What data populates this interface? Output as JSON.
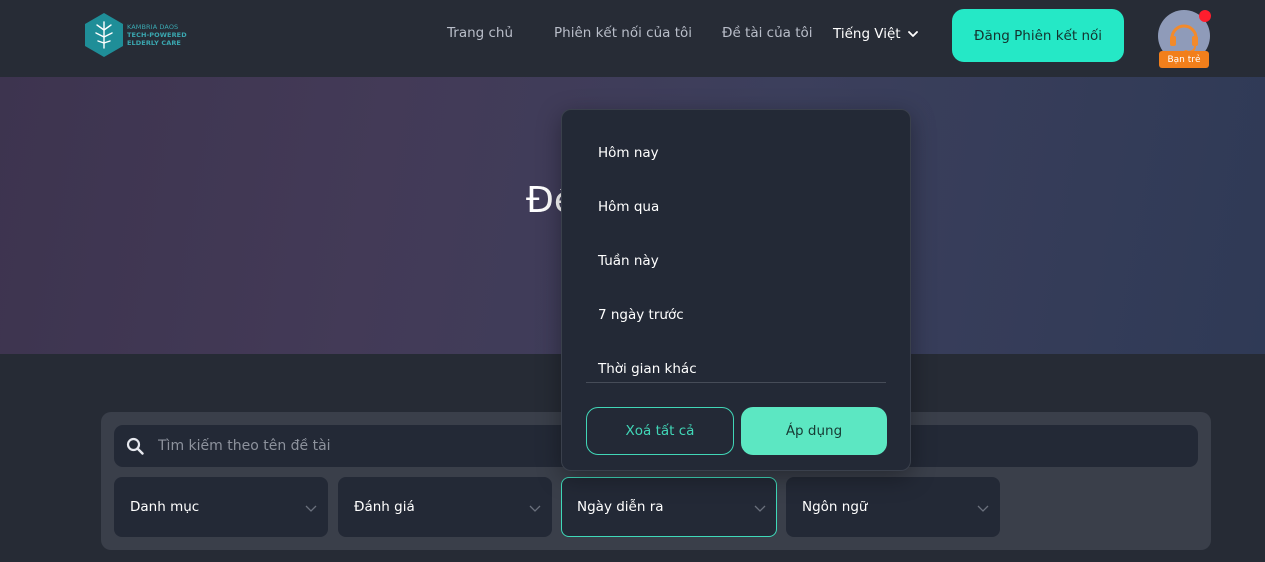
{
  "brand": {
    "line1": "KAMBRIA DAOS",
    "line2": "TECH-POWERED",
    "line3": "ELDERLY CARE"
  },
  "nav": {
    "items": [
      {
        "label": "Trang chủ"
      },
      {
        "label": "Phiên kết nối của tôi"
      },
      {
        "label": "Đề tài của tôi"
      }
    ],
    "language": "Tiếng Việt",
    "cta_label": "Đăng Phiên kết nối",
    "user_role": "Bạn trẻ"
  },
  "hero": {
    "title_visible": "Đề"
  },
  "search": {
    "placeholder": "Tìm kiếm theo tên đề tài"
  },
  "filters": [
    {
      "label": "Danh mục"
    },
    {
      "label": "Đánh giá"
    },
    {
      "label": "Ngày diễn ra"
    },
    {
      "label": "Ngôn ngữ"
    }
  ],
  "date_dropdown": {
    "options": [
      {
        "label": "Hôm nay"
      },
      {
        "label": "Hôm qua"
      },
      {
        "label": "Tuần này"
      },
      {
        "label": "7 ngày trước"
      },
      {
        "label": "Thời gian khác"
      }
    ],
    "clear_label": "Xoá tất cả",
    "apply_label": "Áp dụng"
  },
  "colors": {
    "accent": "#25e8c6",
    "badge": "#f27f1b",
    "notification": "#ff1e2d"
  }
}
